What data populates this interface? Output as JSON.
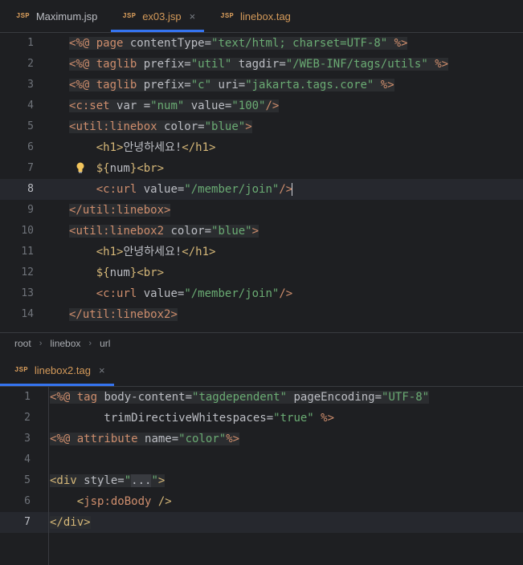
{
  "top_tabs": [
    {
      "icon": "JSP",
      "label": "Maximum.jsp",
      "active": false
    },
    {
      "icon": "JSP",
      "label": "ex03.jsp",
      "active": true
    },
    {
      "icon": "JSP",
      "label": "linebox.tag",
      "active": false
    }
  ],
  "close_glyph": "×",
  "editor1": {
    "line_numbers": [
      "1",
      "2",
      "3",
      "4",
      "5",
      "6",
      "7",
      "8",
      "9",
      "10",
      "11",
      "12",
      "13",
      "14"
    ],
    "lines": [
      [
        [
          "d",
          "<%@ "
        ],
        [
          "k",
          "page "
        ],
        [
          "a",
          "contentType="
        ],
        [
          "s",
          "\"text/html; charset=UTF-8\""
        ],
        [
          "d",
          " %>"
        ]
      ],
      [
        [
          "d",
          "<%@ "
        ],
        [
          "k",
          "taglib "
        ],
        [
          "a",
          "prefix="
        ],
        [
          "s",
          "\"util\""
        ],
        [
          "a",
          " tagdir="
        ],
        [
          "s",
          "\"/WEB-INF/tags/utils\""
        ],
        [
          "d",
          " %>"
        ]
      ],
      [
        [
          "d",
          "<%@ "
        ],
        [
          "k",
          "taglib "
        ],
        [
          "a",
          "prefix="
        ],
        [
          "s",
          "\"c\""
        ],
        [
          "a",
          " uri="
        ],
        [
          "s",
          "\"jakarta.tags.core\""
        ],
        [
          "d",
          " %>"
        ]
      ],
      [
        [
          "d",
          "<"
        ],
        [
          "k",
          "c:set"
        ],
        [
          "a",
          " var ="
        ],
        [
          "s",
          "\"num\""
        ],
        [
          "a",
          " value="
        ],
        [
          "s",
          "\"100\""
        ],
        [
          "d",
          "/>"
        ]
      ],
      [
        [
          "d",
          "<"
        ],
        [
          "k",
          "util:linebox"
        ],
        [
          "a",
          " color="
        ],
        [
          "s",
          "\"blue\""
        ],
        [
          "d",
          ">"
        ]
      ],
      [
        [
          "t",
          "    "
        ],
        [
          "g",
          "<h1>"
        ],
        [
          "t",
          "안녕하세요!"
        ],
        [
          "g",
          "</h1>"
        ]
      ],
      [
        [
          "t",
          "    "
        ],
        [
          "g",
          "${"
        ],
        [
          "t",
          "num"
        ],
        [
          "g",
          "}"
        ],
        [
          "g",
          "<br>"
        ]
      ],
      [
        [
          "t",
          "    "
        ],
        [
          "d",
          "<"
        ],
        [
          "k",
          "c:url"
        ],
        [
          "a",
          " value="
        ],
        [
          "s",
          "\"/member/join\""
        ],
        [
          "d",
          "/>"
        ]
      ],
      [
        [
          "d",
          "</"
        ],
        [
          "k",
          "util:linebox"
        ],
        [
          "d",
          ">"
        ]
      ],
      [
        [
          "d",
          "<"
        ],
        [
          "k",
          "util:linebox2"
        ],
        [
          "a",
          " color="
        ],
        [
          "s",
          "\"blue\""
        ],
        [
          "d",
          ">"
        ]
      ],
      [
        [
          "t",
          "    "
        ],
        [
          "g",
          "<h1>"
        ],
        [
          "t",
          "안녕하세요!"
        ],
        [
          "g",
          "</h1>"
        ]
      ],
      [
        [
          "t",
          "    "
        ],
        [
          "g",
          "${"
        ],
        [
          "t",
          "num"
        ],
        [
          "g",
          "}"
        ],
        [
          "g",
          "<br>"
        ]
      ],
      [
        [
          "t",
          "    "
        ],
        [
          "d",
          "<"
        ],
        [
          "k",
          "c:url"
        ],
        [
          "a",
          " value="
        ],
        [
          "s",
          "\"/member/join\""
        ],
        [
          "d",
          "/>"
        ]
      ],
      [
        [
          "d",
          "</"
        ],
        [
          "k",
          "util:linebox2"
        ],
        [
          "d",
          ">"
        ]
      ]
    ],
    "current_line": "8"
  },
  "breadcrumb": [
    "root",
    "linebox",
    "url"
  ],
  "breadcrumb_sep": "›",
  "bottom_tab": {
    "icon": "JSP",
    "label": "linebox2.tag"
  },
  "editor2": {
    "line_numbers": [
      "1",
      "2",
      "3",
      "4",
      "5",
      "6",
      "7"
    ],
    "lines": [
      [
        [
          "d",
          "<%@ "
        ],
        [
          "k",
          "tag "
        ],
        [
          "a",
          "body-content="
        ],
        [
          "s",
          "\"tagdependent\""
        ],
        [
          "a",
          " pageEncoding="
        ],
        [
          "s",
          "\"UTF-8\""
        ]
      ],
      [
        [
          "a",
          "        trimDirectiveWhitespaces="
        ],
        [
          "s",
          "\"true\""
        ],
        [
          "d",
          " %>"
        ]
      ],
      [
        [
          "d",
          "<%@ "
        ],
        [
          "k",
          "attribute "
        ],
        [
          "a",
          "name="
        ],
        [
          "s",
          "\"color\""
        ],
        [
          "d",
          "%>"
        ]
      ],
      [],
      [
        [
          "g",
          "<div"
        ],
        [
          "a",
          " style="
        ],
        [
          "s",
          "\""
        ],
        [
          "f",
          "..."
        ],
        [
          "s",
          "\""
        ],
        [
          "g",
          ">"
        ]
      ],
      [
        [
          "t",
          "    "
        ],
        [
          "g",
          "<"
        ],
        [
          "k",
          "jsp:doBody"
        ],
        [
          "g",
          " />"
        ]
      ],
      [
        [
          "g",
          "</div>"
        ]
      ]
    ],
    "current_line": "7"
  },
  "colors": {
    "background": "#1e1f22",
    "keyword": "#cf8e6d",
    "tag": "#d5b778",
    "string": "#6aab73",
    "text": "#bcbec4",
    "accent": "#3574f0"
  },
  "icons": [
    "lightbulb-icon",
    "close-icon",
    "jsp-file-icon"
  ]
}
